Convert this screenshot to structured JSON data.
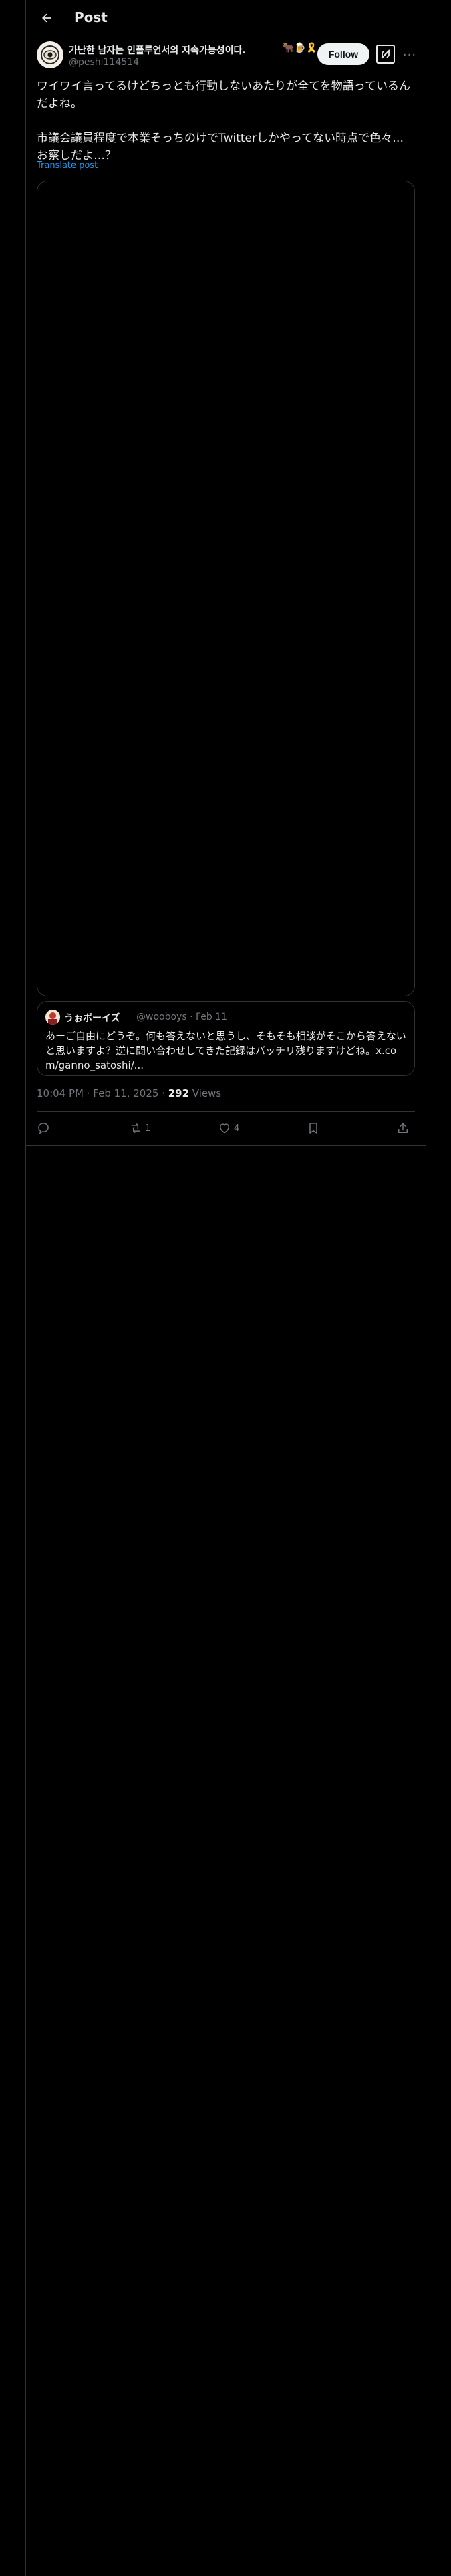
{
  "header": {
    "title": "Post"
  },
  "author": {
    "display_name": "가난한 남자는 인플루언서의 지속가능성이다.",
    "name_emojis": "🐂🍺🎗️",
    "handle": "@peshi114514",
    "follow_label": "Follow",
    "more_label": "···"
  },
  "post": {
    "text": "ワイワイ言ってるけどちっとも行動しないあたりが全てを物語っているんだよね。\n\n市議会議員程度で本業そっちのけでTwitterしかやってない時点で色々…お察しだよ…？",
    "translate_label": "Translate post"
  },
  "quote": {
    "name": "うぉボーイズ",
    "handle_date": "@wooboys · Feb 11",
    "text": "あーご自由にどうぞ。何も答えないと思うし、そもそも相談がそこから答えないと思いますよ？逆に問い合わせしてきた記録はバッチリ残りますけどね。x.com/ganno_satoshi/..."
  },
  "meta": {
    "timestamp": "10:04 PM · Feb 11, 2025 · ",
    "views_count": "292",
    "views_label": " Views"
  },
  "actions": {
    "reply_count": "",
    "repost_count": "1",
    "like_count": "4"
  },
  "colors": {
    "background": "#000000",
    "text": "#e7e9ea",
    "muted": "#71767b",
    "accent": "#1d9bf0",
    "border": "#2f3336"
  }
}
